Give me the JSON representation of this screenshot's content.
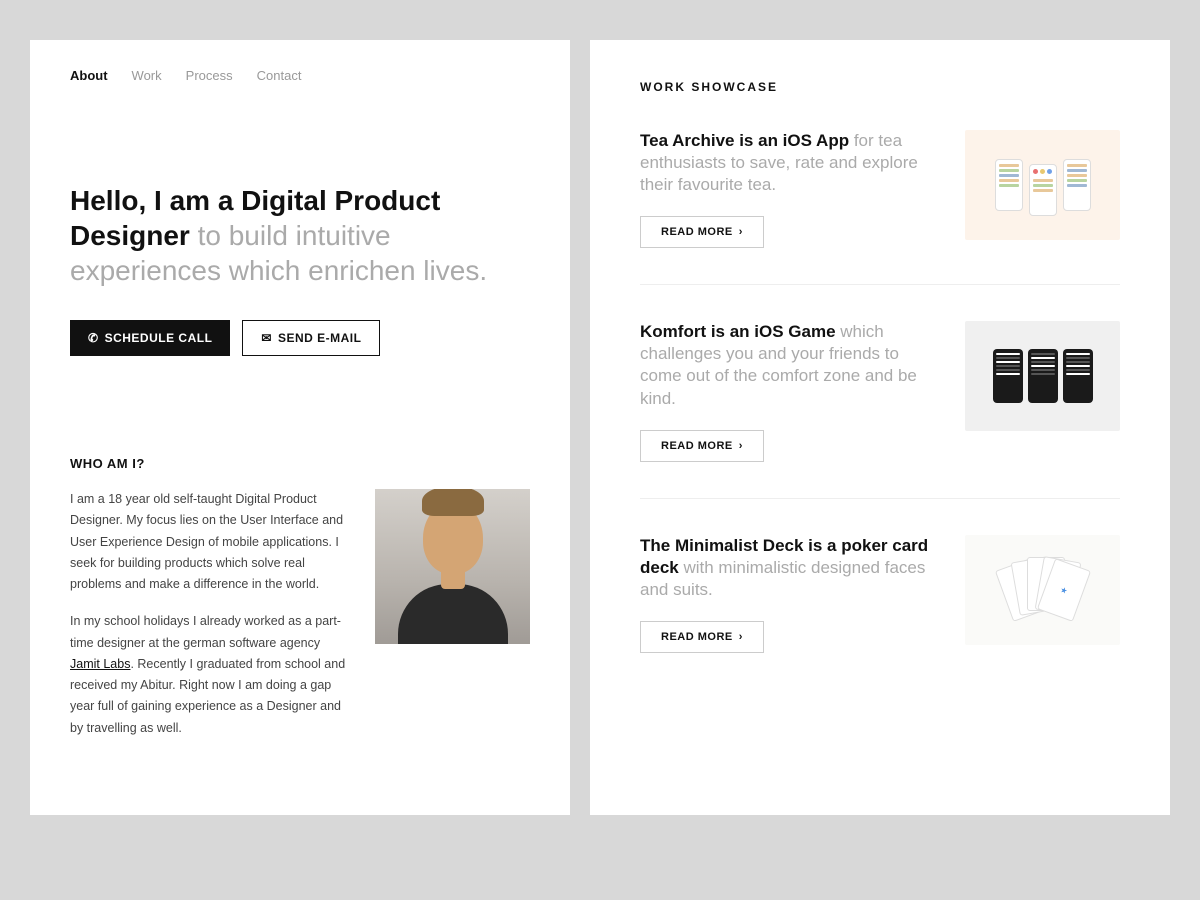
{
  "nav": {
    "items": [
      {
        "label": "About",
        "active": true
      },
      {
        "label": "Work",
        "active": false
      },
      {
        "label": "Process",
        "active": false
      },
      {
        "label": "Contact",
        "active": false
      }
    ]
  },
  "hero": {
    "heading_bold": "Hello, I am a Digital Product Designer",
    "heading_light": " to build intuitive experiences which enrichen lives.",
    "btn_schedule": "SCHEDULE CALL",
    "btn_email": "SEND E-MAIL"
  },
  "who": {
    "heading": "WHO AM I?",
    "para1": "I am a 18 year old self-taught Digital Product Designer. My focus lies on the User Interface and User Experience Design of mobile applications. I seek for building products which solve real problems and make a difference in the world.",
    "para2_prefix": "In my school holidays I already worked as a part-time designer at the german software agency ",
    "para2_link": "Jamit Labs",
    "para2_suffix": ". Recently I graduated from school and received my Abitur. Right now I am doing a gap year full of gaining experience as a Designer and by travelling as well."
  },
  "work": {
    "section_title": "WORK SHOWCASE",
    "projects": [
      {
        "title_bold": "Tea Archive is an iOS App",
        "title_light": " for tea enthusiasts to save, rate and explore their favourite tea.",
        "read_more": "READ MORE"
      },
      {
        "title_bold": "Komfort is an iOS Game",
        "title_light": " which challenges you and your friends to come out of the comfort zone and be kind.",
        "read_more": "READ MORE"
      },
      {
        "title_bold": "The Minimalist Deck is a poker card deck",
        "title_light": " with minimalistic designed faces and suits.",
        "read_more": "READ MORE"
      }
    ]
  },
  "icons": {
    "phone": "📞",
    "email": "✉",
    "chevron": "›"
  }
}
